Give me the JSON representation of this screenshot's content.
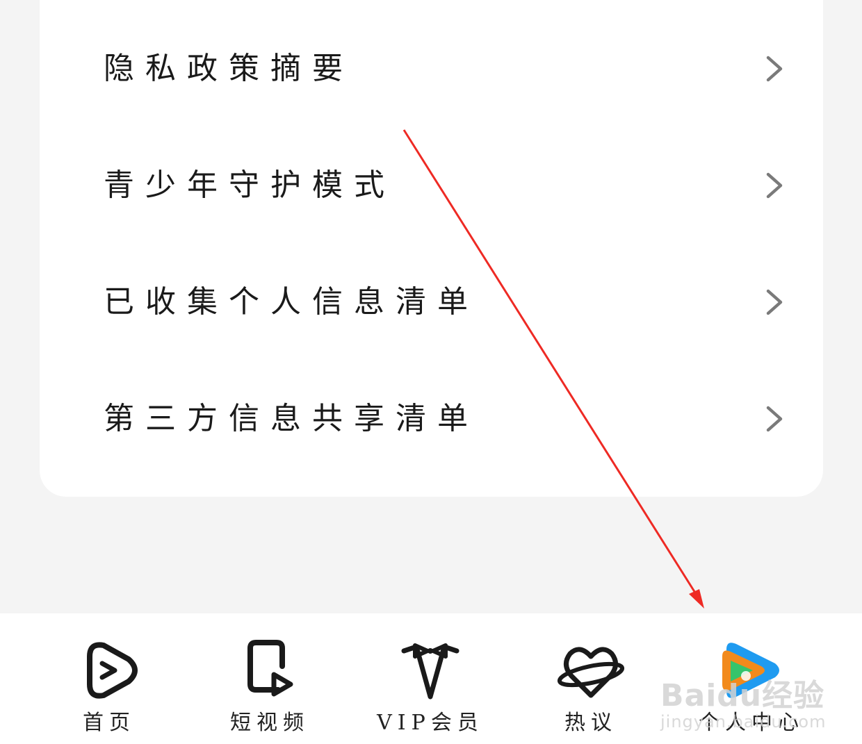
{
  "menu": {
    "items": [
      {
        "label": "隐私政策摘要"
      },
      {
        "label": "青少年守护模式"
      },
      {
        "label": "已收集个人信息清单"
      },
      {
        "label": "第三方信息共享清单"
      }
    ]
  },
  "tabbar": {
    "tabs": [
      {
        "label": "首页",
        "icon": "play-icon"
      },
      {
        "label": "短视频",
        "icon": "short-video-icon"
      },
      {
        "label": "VIP会员",
        "icon": "vip-bowtie-icon"
      },
      {
        "label": "热议",
        "icon": "heart-planet-icon"
      },
      {
        "label": "个人中心",
        "icon": "tencent-video-logo-icon"
      }
    ]
  },
  "watermark": {
    "main": "Baidu经验",
    "sub": "jingyan.baidu.com"
  },
  "colors": {
    "annotation_arrow": "#ee2a24",
    "chevron": "#7a7a7a",
    "card_bg": "#ffffff",
    "page_bg": "#f4f4f4"
  }
}
